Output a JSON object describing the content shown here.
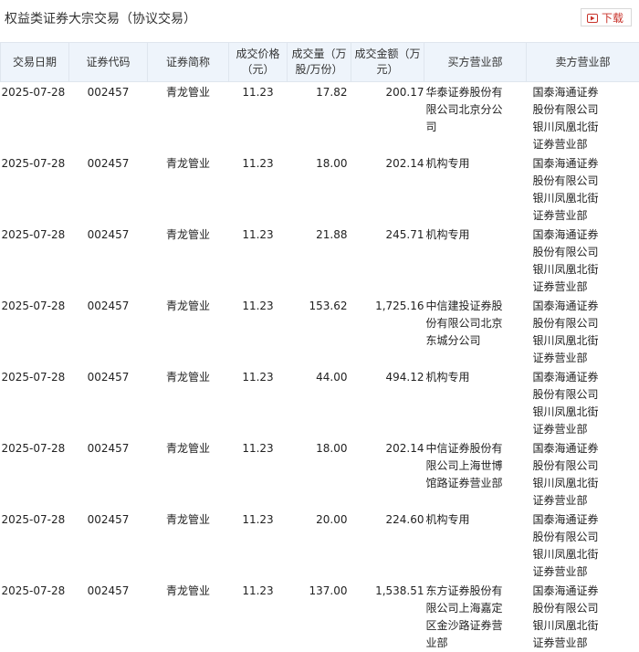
{
  "page": {
    "title": "权益类证券大宗交易（协议交易）",
    "download_label": "下载",
    "accent": "#c8332b",
    "header_bg": "#eef4fb"
  },
  "table": {
    "headers": [
      "交易日期",
      "证券代码",
      "证券简称",
      "成交价格（元）",
      "成交量（万股/万份）",
      "成交金额（万元）",
      "买方营业部",
      "卖方营业部"
    ],
    "rows": [
      {
        "date": "2025-07-28",
        "code": "002457",
        "name": "青龙管业",
        "price": "11.23",
        "volume": "17.82",
        "amount": "200.17",
        "buyer": "华泰证券股份有限公司北京分公司",
        "seller": "国泰海通证券股份有限公司银川凤凰北街证券营业部"
      },
      {
        "date": "2025-07-28",
        "code": "002457",
        "name": "青龙管业",
        "price": "11.23",
        "volume": "18.00",
        "amount": "202.14",
        "buyer": "机构专用",
        "seller": "国泰海通证券股份有限公司银川凤凰北街证券营业部"
      },
      {
        "date": "2025-07-28",
        "code": "002457",
        "name": "青龙管业",
        "price": "11.23",
        "volume": "21.88",
        "amount": "245.71",
        "buyer": "机构专用",
        "seller": "国泰海通证券股份有限公司银川凤凰北街证券营业部"
      },
      {
        "date": "2025-07-28",
        "code": "002457",
        "name": "青龙管业",
        "price": "11.23",
        "volume": "153.62",
        "amount": "1,725.16",
        "buyer": "中信建投证券股份有限公司北京东城分公司",
        "seller": "国泰海通证券股份有限公司银川凤凰北街证券营业部"
      },
      {
        "date": "2025-07-28",
        "code": "002457",
        "name": "青龙管业",
        "price": "11.23",
        "volume": "44.00",
        "amount": "494.12",
        "buyer": "机构专用",
        "seller": "国泰海通证券股份有限公司银川凤凰北街证券营业部"
      },
      {
        "date": "2025-07-28",
        "code": "002457",
        "name": "青龙管业",
        "price": "11.23",
        "volume": "18.00",
        "amount": "202.14",
        "buyer": "中信证券股份有限公司上海世博馆路证券营业部",
        "seller": "国泰海通证券股份有限公司银川凤凰北街证券营业部"
      },
      {
        "date": "2025-07-28",
        "code": "002457",
        "name": "青龙管业",
        "price": "11.23",
        "volume": "20.00",
        "amount": "224.60",
        "buyer": "机构专用",
        "seller": "国泰海通证券股份有限公司银川凤凰北街证券营业部"
      },
      {
        "date": "2025-07-28",
        "code": "002457",
        "name": "青龙管业",
        "price": "11.23",
        "volume": "137.00",
        "amount": "1,538.51",
        "buyer": "东方证券股份有限公司上海嘉定区金沙路证券营业部",
        "seller": "国泰海通证券股份有限公司银川凤凰北街证券营业部"
      }
    ]
  }
}
